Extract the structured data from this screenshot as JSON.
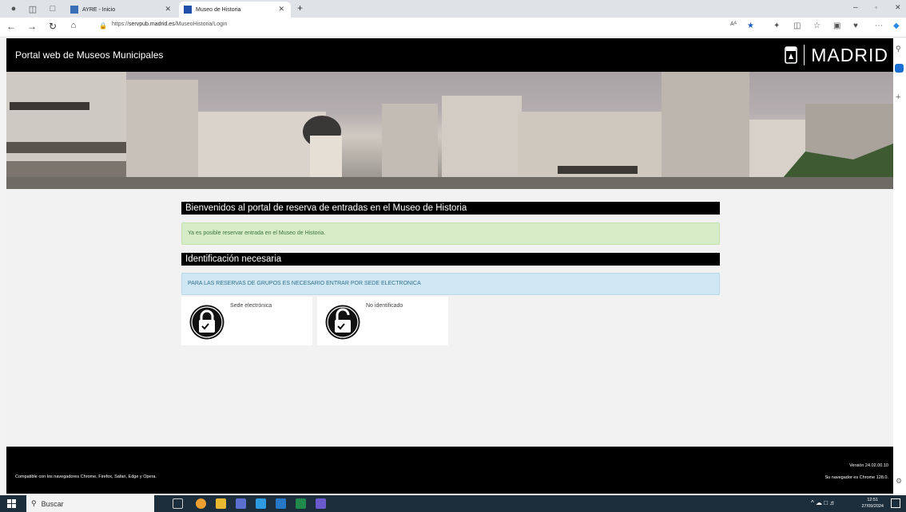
{
  "browser": {
    "tabs": [
      {
        "label": "AYRE - Inicio"
      },
      {
        "label": "Museo de Historia"
      }
    ],
    "new_tab_glyph": "+",
    "url_prefix": "https://",
    "url_host": "servpub.madrid.es",
    "url_path": "/MuseoHistoria/Login",
    "text_size_glyph": "Aᴬ"
  },
  "header": {
    "title": "Portal web de Museos Municipales",
    "brand": "MADRID"
  },
  "content": {
    "welcome": "Bienvenidos al portal de reserva de entradas en el Museo de Historia",
    "notice": "Ya es posible reservar entrada en el Museo de Historia.",
    "id_heading": "Identificación necesaria",
    "groups_info": "PARA LAS RESERVAS DE GRUPOS ES NECESARIO ENTRAR POR SEDE ELECTRONICA",
    "options": [
      {
        "label": "Sede electrónica",
        "icon": "lock-closed-icon"
      },
      {
        "label": "No identificado",
        "icon": "lock-open-icon"
      }
    ]
  },
  "footer": {
    "compat": "Compatible con los navegadores Chrome, Firefox, Safari, Edge y Opera.",
    "version": "Versión 24.02.00.10",
    "browser_info": "Su navegador es Chrome 128.0."
  },
  "taskbar": {
    "search_placeholder": "Buscar",
    "time": "12:51",
    "date": "27/09/2024"
  },
  "colors": {
    "header_bg": "#000000",
    "success_bg": "#d6ecc7",
    "info_bg": "#cfe7f3"
  }
}
